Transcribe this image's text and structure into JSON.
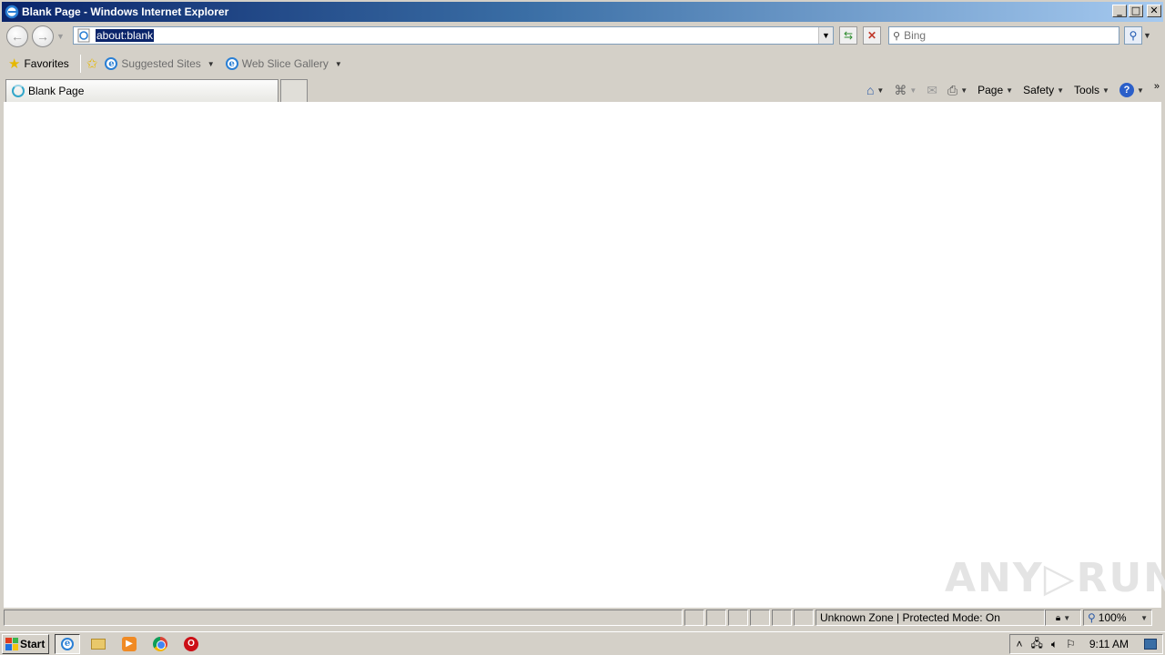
{
  "window": {
    "title": "Blank Page - Windows Internet Explorer"
  },
  "nav": {
    "address": "about:blank",
    "search_placeholder": "Bing"
  },
  "favorites_bar": {
    "favorites_label": "Favorites",
    "items": [
      {
        "label": "Suggested Sites"
      },
      {
        "label": "Web Slice Gallery"
      }
    ]
  },
  "tabs": [
    {
      "label": "Blank Page"
    }
  ],
  "command_bar": {
    "page_label": "Page",
    "safety_label": "Safety",
    "tools_label": "Tools"
  },
  "status_bar": {
    "zone_text": "Unknown Zone | Protected Mode: On",
    "zoom_text": "100%"
  },
  "watermark": "ANY▷RUN",
  "taskbar": {
    "start_label": "Start",
    "clock": "9:11 AM"
  }
}
